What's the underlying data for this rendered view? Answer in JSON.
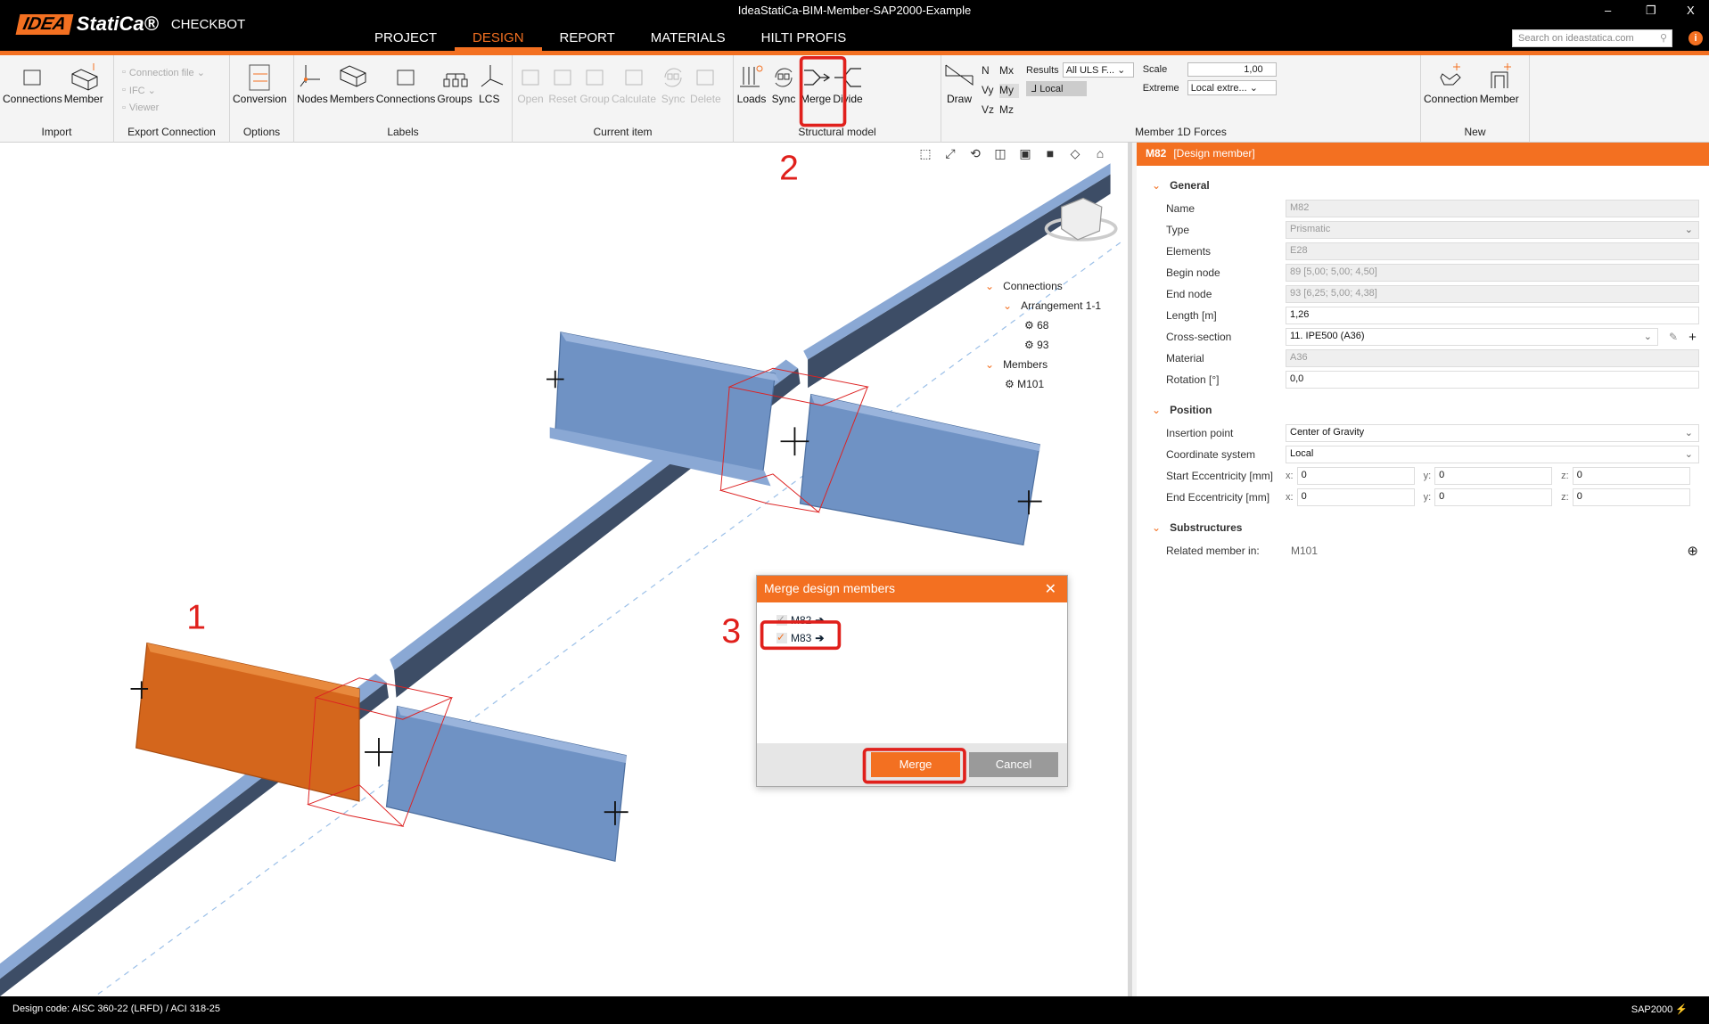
{
  "window": {
    "title": "IdeaStatiCa-BIM-Member-SAP2000-Example",
    "logo_idea": "IDEA",
    "logo_statica": "StatiCa®",
    "app_name": "CHECKBOT",
    "minimize": "–",
    "restore": "❐",
    "close": "X"
  },
  "menu": {
    "tabs": [
      "PROJECT",
      "DESIGN",
      "REPORT",
      "MATERIALS",
      "HILTI PROFIS"
    ],
    "active_index": 1
  },
  "search": {
    "placeholder": "Search on ideastatica.com"
  },
  "ribbon": {
    "groups": [
      {
        "label": "Import",
        "buttons": [
          {
            "label": "Connections",
            "icon": "import-connections-icon"
          },
          {
            "label": "Member",
            "icon": "import-member-icon"
          }
        ]
      },
      {
        "label": "Export Connection",
        "small": [
          {
            "label": "Connection file ⌄",
            "icon": "connection-file-icon"
          },
          {
            "label": "IFC ⌄",
            "icon": "ifc-icon"
          },
          {
            "label": "Viewer",
            "icon": "viewer-icon"
          }
        ]
      },
      {
        "label": "Options",
        "buttons": [
          {
            "label": "Conversion",
            "icon": "conversion-icon"
          }
        ]
      },
      {
        "label": "Labels",
        "buttons": [
          {
            "label": "Nodes",
            "icon": "nodes-icon"
          },
          {
            "label": "Members",
            "icon": "members-icon"
          },
          {
            "label": "Connections",
            "icon": "connections-icon"
          },
          {
            "label": "Groups",
            "icon": "groups-icon"
          },
          {
            "label": "LCS",
            "icon": "lcs-icon"
          }
        ]
      },
      {
        "label": "Current item",
        "buttons": [
          {
            "label": "Open",
            "icon": "open-icon",
            "disabled": true
          },
          {
            "label": "Reset",
            "icon": "reset-icon",
            "disabled": true
          },
          {
            "label": "Group",
            "icon": "group-icon",
            "disabled": true
          },
          {
            "label": "Calculate",
            "icon": "calculate-icon",
            "disabled": true
          },
          {
            "label": "Sync",
            "icon": "sync-icon",
            "disabled": true
          },
          {
            "label": "Delete",
            "icon": "delete-icon",
            "disabled": true
          }
        ]
      },
      {
        "label": "Structural model",
        "buttons": [
          {
            "label": "Loads",
            "icon": "loads-icon"
          },
          {
            "label": "Sync",
            "icon": "sync-icon"
          },
          {
            "label": "Merge",
            "icon": "merge-icon"
          },
          {
            "label": "Divide",
            "icon": "divide-icon"
          }
        ]
      },
      {
        "label": "Member 1D Forces",
        "forces": true
      },
      {
        "label": "New",
        "buttons": [
          {
            "label": "Connection",
            "icon": "new-connection-icon"
          },
          {
            "label": "Member",
            "icon": "new-member-icon"
          }
        ]
      }
    ]
  },
  "forces": {
    "draw": "Draw",
    "components": [
      "N",
      "Mx",
      "Vy",
      "My",
      "Vz",
      "Mz"
    ],
    "results_label": "Results",
    "results_value": "All ULS F...",
    "local": "Local",
    "scale_label": "Scale",
    "scale_value": "1,00",
    "extreme_label": "Extreme",
    "extreme_value": "Local extre..."
  },
  "tree": {
    "connections": "Connections",
    "arrangement": "Arrangement 1-1",
    "conn_items": [
      "68",
      "93"
    ],
    "members": "Members",
    "member_items": [
      "M101"
    ]
  },
  "panel": {
    "id": "M82",
    "kind": "[Design member]",
    "general": {
      "title": "General",
      "name_label": "Name",
      "name": "M82",
      "type_label": "Type",
      "type": "Prismatic",
      "elements_label": "Elements",
      "elements": "E28",
      "begin_label": "Begin node",
      "begin": "89 [5,00; 5,00; 4,50]",
      "end_label": "End node",
      "end": "93 [6,25; 5,00; 4,38]",
      "length_label": "Length [m]",
      "length": "1,26",
      "cs_label": "Cross-section",
      "cs": "11. IPE500 (A36)",
      "material_label": "Material",
      "material": "A36",
      "rotation_label": "Rotation [°]",
      "rotation": "0,0"
    },
    "position": {
      "title": "Position",
      "insertion_label": "Insertion point",
      "insertion": "Center of Gravity",
      "coord_label": "Coordinate system",
      "coord": "Local",
      "start_label": "Start Eccentricity [mm]",
      "end_label": "End  Eccentricity [mm]",
      "x": "x:",
      "y": "y:",
      "z": "z:",
      "start": [
        "0",
        "0",
        "0"
      ],
      "end": [
        "0",
        "0",
        "0"
      ]
    },
    "substructures": {
      "title": "Substructures",
      "related_label": "Related member in:",
      "related": "M101"
    }
  },
  "dialog": {
    "title": "Merge design members",
    "items": [
      {
        "label": "M82",
        "checked": true,
        "disabled": true
      },
      {
        "label": "M83",
        "checked": true
      }
    ],
    "merge": "Merge",
    "cancel": "Cancel"
  },
  "annotations": [
    "1",
    "2",
    "3"
  ],
  "status": {
    "design_code_label": "Design code:",
    "design_code": "AISC 360-22 (LRFD) / ACI 318-25",
    "source": "SAP2000"
  },
  "colors": {
    "accent": "#f37021",
    "highlight": "#e0201c",
    "member_blue": "#6f92c4",
    "selected_member": "#d4661c"
  }
}
